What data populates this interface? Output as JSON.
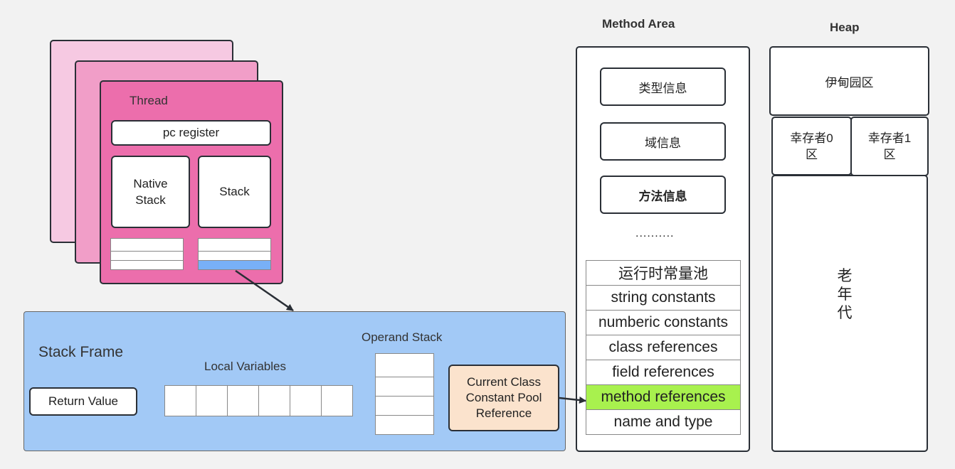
{
  "thread": {
    "title": "Thread",
    "pc_register": "pc register",
    "native_stack": "Native\nStack",
    "stack": "Stack",
    "native_frames": 3,
    "java_frames": 3,
    "active_java_frame_index": 2,
    "colors": {
      "back": "#f6c9e2",
      "middle": "#f19ec8",
      "front": "#ec6eac",
      "active_frame": "#78b0f7"
    }
  },
  "stack_frame": {
    "title": "Stack Frame",
    "return_value": "Return Value",
    "local_variables_label": "Local Variables",
    "local_variable_slots": 6,
    "operand_stack_label": "Operand Stack",
    "operand_stack_slots": 4,
    "constant_pool_ref": "Current Class\nConstant Pool\nReference",
    "colors": {
      "background": "#a2c9f6",
      "constant_pool_ref": "#fbe3cd"
    }
  },
  "method_area": {
    "title": "Method Area",
    "items": [
      "类型信息",
      "域信息",
      "方法信息"
    ],
    "ellipsis": "..........",
    "runtime_constant_pool": [
      {
        "label": "运行时常量池",
        "highlight": false
      },
      {
        "label": "string constants",
        "highlight": false
      },
      {
        "label": "numberic constants",
        "highlight": false
      },
      {
        "label": "class references",
        "highlight": false
      },
      {
        "label": "field references",
        "highlight": false
      },
      {
        "label": "method references",
        "highlight": true
      },
      {
        "label": "name and type",
        "highlight": false
      }
    ],
    "highlight_color": "#a8f14e"
  },
  "heap": {
    "title": "Heap",
    "eden": "伊甸园区",
    "survivor0": "幸存者0\n区",
    "survivor1": "幸存者1\n区",
    "old_gen": "老\n年\n代"
  },
  "arrows": [
    {
      "from": "active-java-frame",
      "to": "stack-frame"
    },
    {
      "from": "constant-pool-reference",
      "to": "method-references"
    }
  ]
}
